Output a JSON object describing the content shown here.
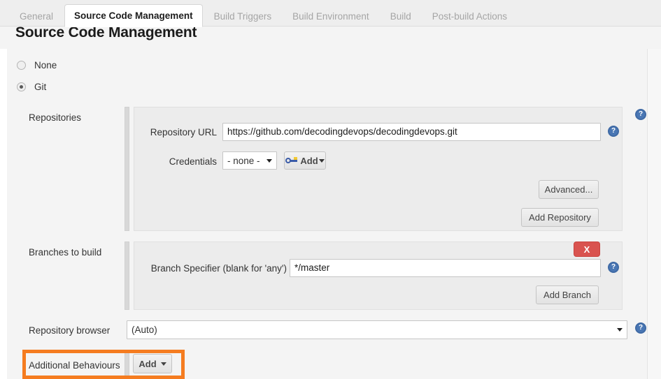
{
  "tabs": [
    {
      "label": "General",
      "active": false
    },
    {
      "label": "Source Code Management",
      "active": true
    },
    {
      "label": "Build Triggers",
      "active": false
    },
    {
      "label": "Build Environment",
      "active": false
    },
    {
      "label": "Build",
      "active": false
    },
    {
      "label": "Post-build Actions",
      "active": false
    }
  ],
  "page_title": "Source Code Management",
  "scm_options": [
    {
      "label": "None",
      "checked": false
    },
    {
      "label": "Git",
      "checked": true
    }
  ],
  "repositories": {
    "section_label": "Repositories",
    "url_label": "Repository URL",
    "url_value": "https://github.com/decodingdevops/decodingdevops.git",
    "credentials_label": "Credentials",
    "credentials_value": "- none -",
    "add_credentials_label": "Add",
    "add_credentials_icon": "key-icon",
    "advanced_label": "Advanced...",
    "add_repository_label": "Add Repository"
  },
  "branches": {
    "section_label": "Branches to build",
    "specifier_label": "Branch Specifier (blank for 'any')",
    "specifier_value": "*/master",
    "delete_label": "X",
    "add_branch_label": "Add Branch"
  },
  "repository_browser": {
    "label": "Repository browser",
    "value": "(Auto)"
  },
  "additional_behaviours": {
    "label": "Additional Behaviours",
    "add_label": "Add"
  },
  "icons": {
    "help": "?"
  },
  "colors": {
    "highlight": "#f57c20",
    "delete": "#d9534f",
    "help": "#4a77b4"
  }
}
